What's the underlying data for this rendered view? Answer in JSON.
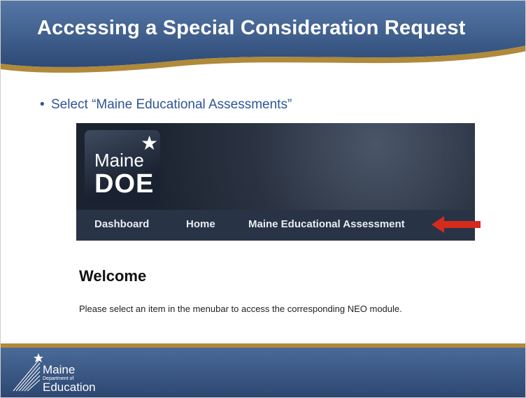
{
  "slide": {
    "title": "Accessing a Special Consideration Request",
    "bullet": "Select “Maine Educational Assessments”"
  },
  "screenshot": {
    "logo": {
      "line1": "Maine",
      "line2": "DOE"
    },
    "menu": [
      {
        "label": "Dashboard"
      },
      {
        "label": "Home"
      },
      {
        "label": "Maine Educational Assessment"
      }
    ],
    "welcome_title": "Welcome",
    "welcome_message": "Please select an item in the menubar to access the corresponding NEO module."
  },
  "footer": {
    "logo_line1": "Maine",
    "logo_line2": "Department of",
    "logo_line3": "Education"
  },
  "colors": {
    "header_blue": "#3d5a86",
    "gold": "#b08a3a",
    "arrow_red": "#d42b1c",
    "bullet_text": "#2f5496"
  }
}
